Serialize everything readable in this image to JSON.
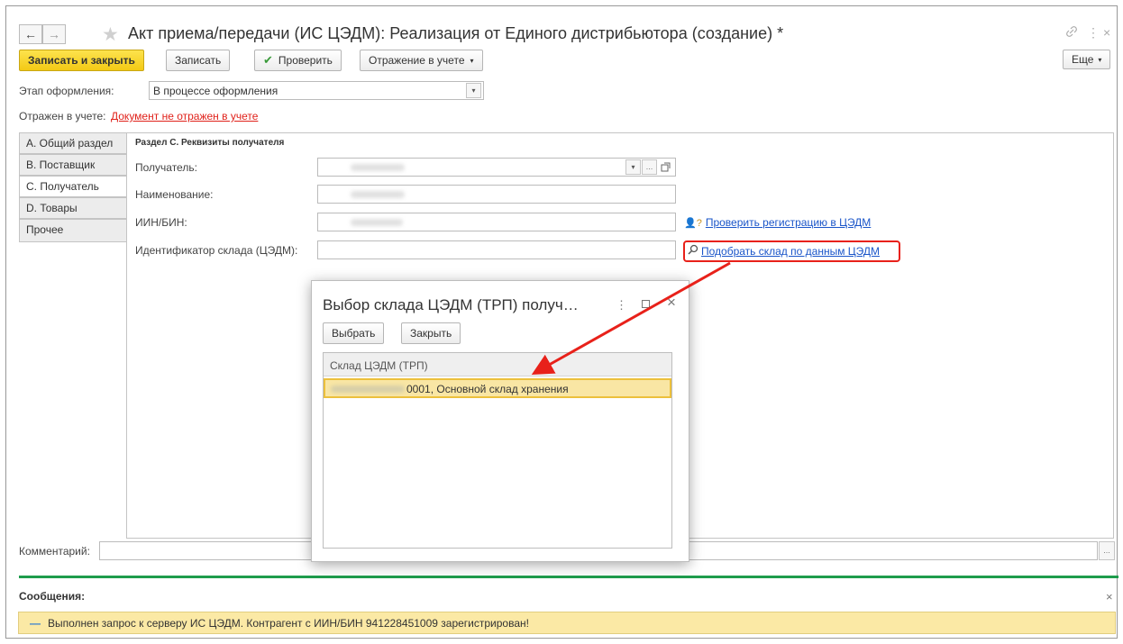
{
  "window": {
    "title": "Акт приема/передачи (ИС ЦЭДМ): Реализация от Единого дистрибьютора (создание) *",
    "nav_back": "←",
    "nav_forward": "→",
    "link_icon": "🔗",
    "more_icon": "⋮",
    "close_icon": "×"
  },
  "toolbar": {
    "save_close": "Записать и закрыть",
    "save": "Записать",
    "check": "Проверить",
    "check_mark": "✔",
    "posting": "Отражение в учете",
    "more": "Еще"
  },
  "stage": {
    "label": "Этап оформления:",
    "value": "В процессе оформления"
  },
  "posted": {
    "label": "Отражен в учете:",
    "value": "Документ не отражен в учете"
  },
  "tabs": [
    "А. Общий раздел",
    "В. Поставщик",
    "С. Получатель",
    "D. Товары",
    "Прочее"
  ],
  "section": {
    "title": "Раздел С. Реквизиты получателя",
    "recipient_label": "Получатель:",
    "name_label": "Наименование:",
    "iin_label": "ИИН/БИН:",
    "warehouse_label": "Идентификатор склада (ЦЭДМ):",
    "check_registration_link": "Проверить регистрацию в ЦЭДМ",
    "pick_warehouse_link": "Подобрать склад по данным ЦЭДМ"
  },
  "dialog": {
    "title": "Выбор склада ЦЭДМ (ТРП) получ…",
    "select_button": "Выбрать",
    "close_button": "Закрыть",
    "column_header": "Склад ЦЭДМ (ТРП)",
    "rows": [
      "0001, Основной склад хранения"
    ]
  },
  "comment": {
    "label": "Комментарий:",
    "value": ""
  },
  "messages": {
    "title": "Сообщения:",
    "text": "Выполнен запрос к серверу ИС ЦЭДМ. Контрагент с ИИН/БИН 941228451009 зарегистрирован!"
  },
  "colors": {
    "primary_button": "#f5cf20",
    "link": "#1a55c9",
    "warning_link": "#e0211a",
    "annotation": "#e8211a",
    "message_bar": "#fbe9a5",
    "divider": "#1e9c4c",
    "selected_row": "#f9e6a4"
  }
}
